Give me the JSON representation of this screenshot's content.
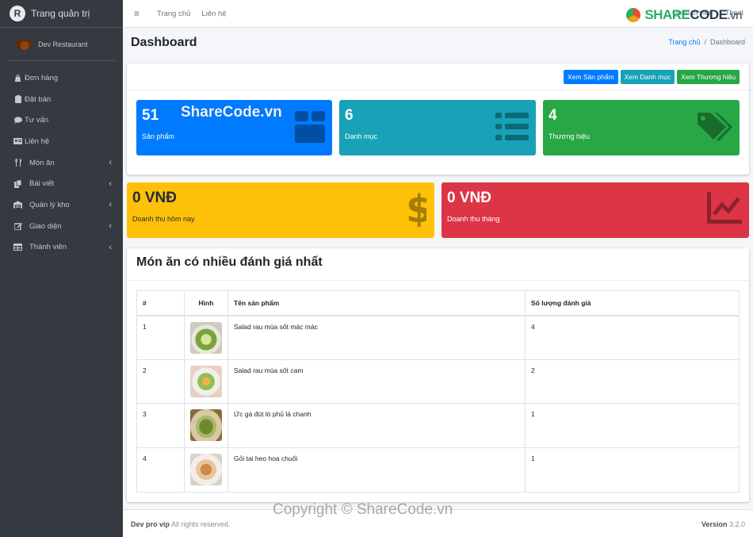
{
  "sidebar": {
    "brand": "Trang quản trị",
    "brand_logo_letter": "R",
    "user": "Dev Restaurant",
    "items": [
      {
        "label": "Đơn hàng",
        "icon": "shopping-bag-icon",
        "has_children": false
      },
      {
        "label": "Đặt bàn",
        "icon": "clipboard-icon",
        "has_children": false
      },
      {
        "label": "Tư vấn",
        "icon": "comment-icon",
        "has_children": false
      },
      {
        "label": "Liên hệ",
        "icon": "id-card-icon",
        "has_children": false
      },
      {
        "label": "Món ăn",
        "icon": "utensils-icon",
        "has_children": true
      },
      {
        "label": "Bài viết",
        "icon": "copy-icon",
        "has_children": true
      },
      {
        "label": "Quản lý kho",
        "icon": "warehouse-icon",
        "has_children": true
      },
      {
        "label": "Giao diện",
        "icon": "edit-icon",
        "has_children": true
      },
      {
        "label": "Thành viên",
        "icon": "table-icon",
        "has_children": true
      }
    ]
  },
  "topbar": {
    "home_link": "Trang chủ",
    "contact_link": "Liên hệ",
    "admin_link": "Quản trị viên",
    "logout_link": "Thoát"
  },
  "header": {
    "title": "Dashboard",
    "breadcrumb_home": "Trang chủ",
    "breadcrumb_sep": "/",
    "breadcrumb_current": "Dashboard"
  },
  "actions": {
    "view_products": "Xem Sản phẩm",
    "view_categories": "Xem Danh mục",
    "view_brands": "Xem Thương hiệu"
  },
  "stats": {
    "products": {
      "value": "51",
      "label": "Sản phẩm"
    },
    "categories": {
      "value": "6",
      "label": "Danh mục"
    },
    "brands": {
      "value": "4",
      "label": "Thương hiệu"
    },
    "revenue_today": {
      "value": "0 VNĐ",
      "label": "Doanh thu hôm nay"
    },
    "revenue_month": {
      "value": "0 VNĐ",
      "label": "Doanh thu tháng"
    }
  },
  "top_rated": {
    "title": "Món ăn có nhiều đánh giá nhất",
    "columns": [
      "#",
      "Hình",
      "Tên sản phẩm",
      "Số lượng đánh giá"
    ],
    "rows": [
      {
        "num": "1",
        "name": "Salad rau mùa sốt mác mác",
        "count": "4"
      },
      {
        "num": "2",
        "name": "Salad rau mùa sốt cam",
        "count": "2"
      },
      {
        "num": "3",
        "name": "Ức gà đút lò phủ lá chanh",
        "count": "1"
      },
      {
        "num": "4",
        "name": "Gỏi tai heo hoa chuối",
        "count": "1"
      }
    ]
  },
  "footer": {
    "brand": "Dev pro vip",
    "rights": " All rights reserved.",
    "version_label": "Version",
    "version_value": " 3.2.0"
  },
  "watermark": {
    "logo_share": "SHARE",
    "logo_code": "CODE",
    "logo_vn": ".vn",
    "text_top": "ShareCode.vn",
    "text_bottom": "Copyright © ShareCode.vn"
  },
  "colors": {
    "sidebar_bg": "#343a40",
    "primary": "#007bff",
    "info": "#17a2b8",
    "success": "#28a745",
    "warning": "#ffc107",
    "danger": "#dc3545"
  }
}
